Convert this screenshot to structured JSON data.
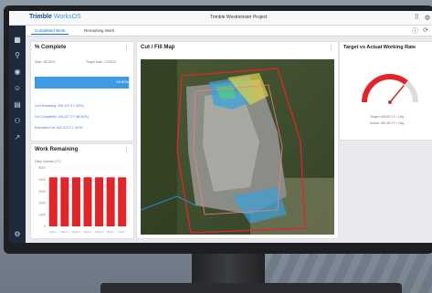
{
  "app": {
    "brand_prefix": "Trimble",
    "brand_suffix": "WorksOS",
    "project_title": "Trimble Westminster Project"
  },
  "tabs": [
    {
      "label": "Completed Work"
    },
    {
      "label": "Remaining Work"
    }
  ],
  "cards": {
    "percent_complete": {
      "title": "% Complete",
      "start_label": "Start: 08/15/21",
      "target_label": "Target Date: 12/30/21",
      "bar_value_text": "68.60%",
      "progress": 0.986,
      "cut_remaining": "Cut Remaining: 205,479 CY (32%)",
      "cut_completed": "Cut Completed: 440,427 CY (68.60%)",
      "estimated_cut": "Estimated Cut: 642,472 CY 100%"
    },
    "cut_fill_map": {
      "title": "Cut / Fill Map"
    },
    "target_rate": {
      "title": "Target vs Actual Working Rate",
      "target_text": "Target: 583.60 CY / Day",
      "actual_text": "Actual: 481.49 CY / Day",
      "gauge_fraction": 0.72
    },
    "work_remaining": {
      "title": "Work Remaining",
      "ylabel": "Daily Volume (CY)"
    }
  },
  "chart_data": {
    "type": "bar",
    "title": "Work Remaining",
    "ylabel": "Daily Volume (CY)",
    "categories": [
      "Week 1",
      "Week 2",
      "Week 3",
      "Week 4",
      "Week 5",
      "Week 6",
      "Week 7"
    ],
    "values": [
      4200,
      4200,
      4200,
      4200,
      4200,
      4200,
      4200
    ],
    "ylim": [
      0,
      5000
    ],
    "yticks": [
      0,
      1000,
      2000,
      3000,
      4000,
      5000
    ],
    "color": "#e0262a"
  },
  "icons": {
    "sidebar": [
      "menu-icon",
      "dashboard-icon",
      "map-pin-icon",
      "location-icon",
      "person-icon",
      "report-icon",
      "users-icon",
      "trend-icon",
      "settings-icon"
    ],
    "top_right": [
      "apps-icon",
      "help-icon"
    ],
    "tabs_right": [
      "info-icon",
      "refresh-icon"
    ]
  },
  "colors": {
    "accent": "#0f6fb9",
    "sidebar": "#1e2a39",
    "bar": "#e0262a",
    "progress": "#3f9ae4"
  }
}
